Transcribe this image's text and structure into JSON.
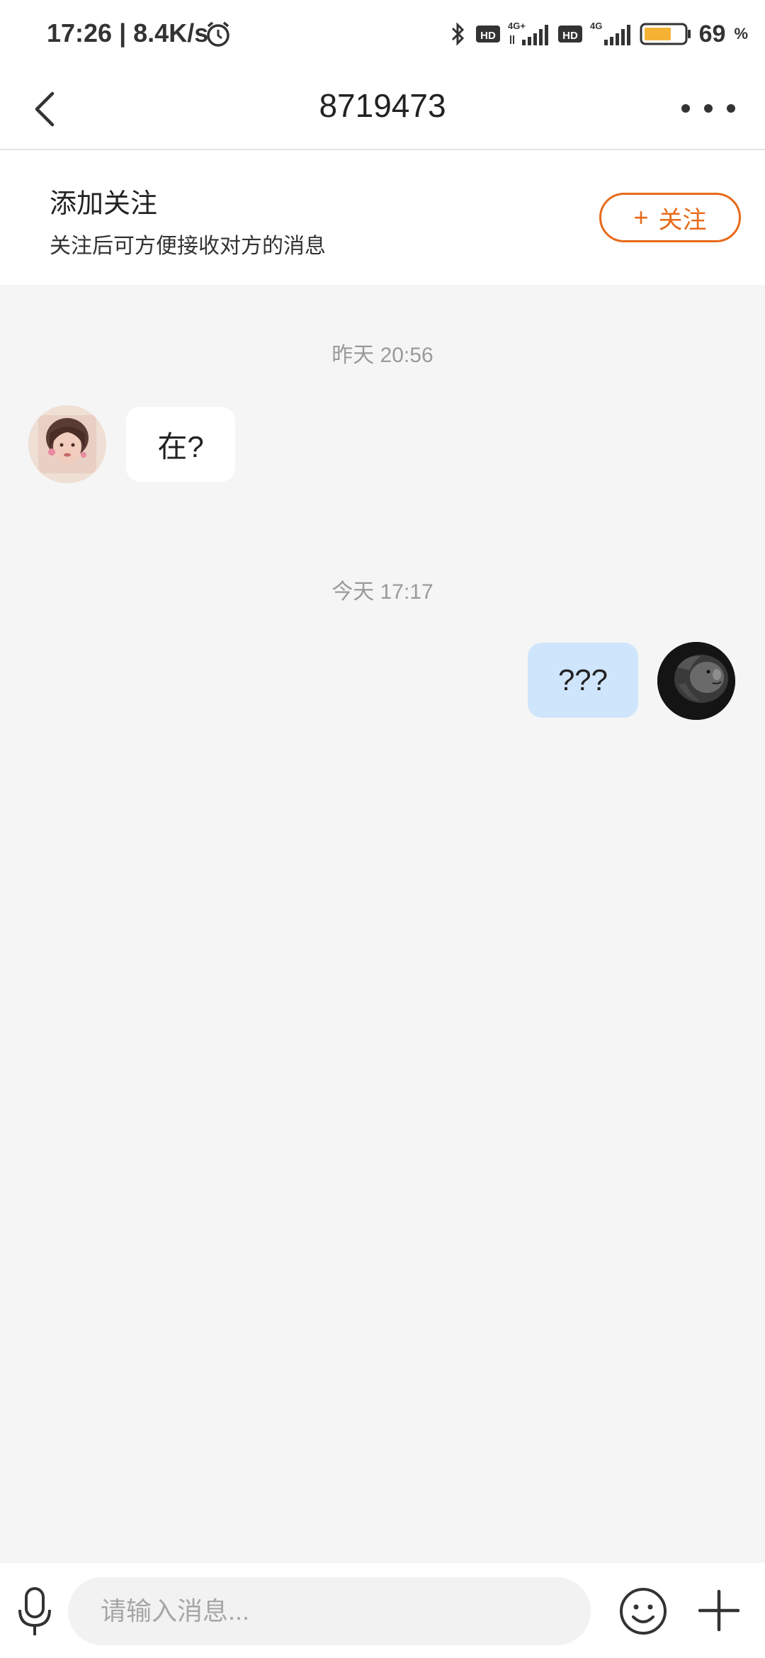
{
  "status_bar": {
    "time_speed": "17:26 | 8.4K/s",
    "net_label_1": "HD",
    "net_type_1": "4G+",
    "net_label_2": "HD",
    "net_type_2": "4G",
    "battery": "69",
    "battery_unit": "%",
    "battery_level": 0.69,
    "icons": [
      "alarm-icon",
      "bluetooth-icon",
      "signal-icon",
      "battery-icon"
    ]
  },
  "header": {
    "title": "8719473",
    "icons": [
      "back-icon",
      "more-icon"
    ]
  },
  "follow_banner": {
    "title": "添加关注",
    "subtitle": "关注后可方便接收对方的消息",
    "button_plus": "+",
    "button_label": "关注",
    "accent_color": "#e86a1a"
  },
  "chat": {
    "messages": [
      {
        "timestamp": "昨天 20:56",
        "side": "left",
        "text": "在?"
      },
      {
        "timestamp": "今天 17:17",
        "side": "right",
        "text": "???"
      }
    ],
    "sent_bubble_color": "#cfe5fb",
    "received_bubble_color": "#ffffff"
  },
  "input_bar": {
    "placeholder": "请输入消息...",
    "value": "",
    "icons": [
      "microphone-icon",
      "emoji-icon",
      "plus-icon"
    ]
  }
}
